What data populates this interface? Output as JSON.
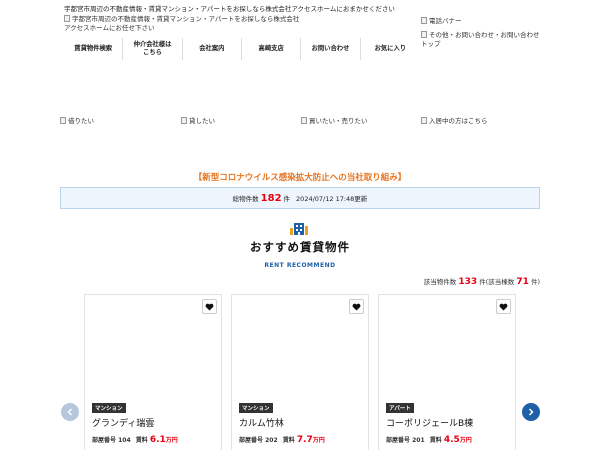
{
  "header": {
    "tagline": "宇都宮市周辺の不動産情報・賃貸マンション・アパートをお探しなら株式会社アクセスホームにおまかせください",
    "logo_alt": "宇都宮市周辺の不動産情報・賃貸マンション・アパートをお探しなら株式会社アクセスホームにお任せ下さい",
    "tel_banner_alt": "電話バナー",
    "contact_alt": "その他・お問い合わせ・お問い合わせトップ"
  },
  "nav": {
    "items": [
      {
        "label": "賃貸物件検索"
      },
      {
        "label": "仲介会社様は\nこちら"
      },
      {
        "label": "会社案内"
      },
      {
        "label": "高崎支店"
      },
      {
        "label": "お問い合わせ"
      },
      {
        "label": "お気に入り"
      }
    ]
  },
  "banners": [
    {
      "alt": "借りたい"
    },
    {
      "alt": "貸したい"
    },
    {
      "alt": "買いたい・売りたい"
    },
    {
      "alt": "入居中の方はこちら"
    }
  ],
  "notice": {
    "corona": "【新型コロナウイルス感染拡大防止への当社取り組み】"
  },
  "counter": {
    "label": "総物件数",
    "count": "182",
    "unit": "件",
    "updated": "2024/07/12 17:48更新"
  },
  "recommend": {
    "icon": "building-icon",
    "title": "おすすめ賃貸物件",
    "subtitle": "RENT RECOMMEND",
    "hits_label": "該当物件数",
    "hits_count": "133",
    "hits_unit": "件(該当棟数",
    "buildings_count": "71",
    "buildings_unit": "件)"
  },
  "cards": [
    {
      "type": "マンション",
      "name": "グランディ瑞雲",
      "room_label": "部屋番号",
      "room": "104",
      "rent_label": "賃料",
      "rent": "6.1",
      "rent_unit": "万円"
    },
    {
      "type": "マンション",
      "name": "カルム竹林",
      "room_label": "部屋番号",
      "room": "202",
      "rent_label": "賃料",
      "rent": "7.7",
      "rent_unit": "万円"
    },
    {
      "type": "アパート",
      "name": "コーポリジェールB棟",
      "room_label": "部屋番号",
      "room": "201",
      "rent_label": "賃料",
      "rent": "4.5",
      "rent_unit": "万円"
    }
  ],
  "colors": {
    "accent_blue": "#1f5fa8",
    "price_red": "#e60012",
    "notice_orange": "#e6731e"
  }
}
